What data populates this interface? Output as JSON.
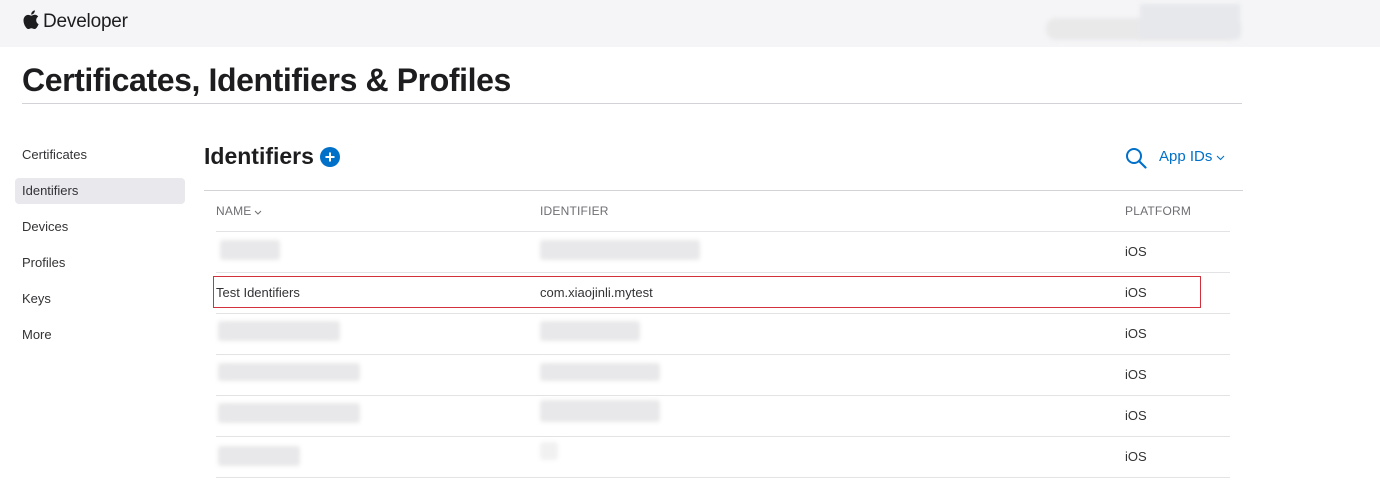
{
  "header": {
    "brand": "Developer",
    "logo_icon": "apple-logo-icon"
  },
  "page": {
    "title": "Certificates, Identifiers & Profiles"
  },
  "sidebar": {
    "items": [
      {
        "label": "Certificates",
        "active": false
      },
      {
        "label": "Identifiers",
        "active": true
      },
      {
        "label": "Devices",
        "active": false
      },
      {
        "label": "Profiles",
        "active": false
      },
      {
        "label": "Keys",
        "active": false
      },
      {
        "label": "More",
        "active": false
      }
    ]
  },
  "section": {
    "title": "Identifiers",
    "add_icon": "plus-circle-icon",
    "search_icon": "search-icon",
    "filter_label": "App IDs",
    "filter_icon": "chevron-down-icon"
  },
  "table": {
    "columns": {
      "name": "NAME",
      "identifier": "IDENTIFIER",
      "platform": "PLATFORM"
    },
    "rows": [
      {
        "name": "",
        "identifier": "",
        "platform": "iOS",
        "redacted": true
      },
      {
        "name": "Test Identifiers",
        "identifier": "com.xiaojinli.mytest",
        "platform": "iOS",
        "redacted": false,
        "highlighted": true
      },
      {
        "name": "",
        "identifier": "",
        "platform": "iOS",
        "redacted": true
      },
      {
        "name": "",
        "identifier": "",
        "platform": "iOS",
        "redacted": true
      },
      {
        "name": "",
        "identifier": "",
        "platform": "iOS",
        "redacted": true
      },
      {
        "name": "",
        "identifier": "",
        "platform": "iOS",
        "redacted": true
      }
    ]
  },
  "colors": {
    "accent": "#0070c9",
    "highlight_border": "#d0313a",
    "topbar_bg": "#f5f5f7",
    "sidebar_active_bg": "#e8e8ed"
  }
}
